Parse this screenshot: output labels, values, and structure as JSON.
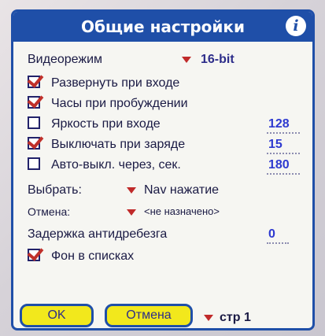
{
  "window": {
    "title": "Общие настройки",
    "info_icon": "info-icon"
  },
  "video_mode": {
    "label": "Видеорежим",
    "value": "16-bit"
  },
  "options": {
    "expand_on_start": {
      "label": "Развернуть при входе",
      "checked": true
    },
    "clock_on_wake": {
      "label": "Часы при пробуждении",
      "checked": true
    },
    "brightness_on_start": {
      "label": "Яркость при входе",
      "checked": false,
      "value": "128"
    },
    "off_on_charge": {
      "label": "Выключать при заряде",
      "checked": true,
      "value": "15"
    },
    "auto_off": {
      "label": "Авто-выкл. через, сек.",
      "checked": false,
      "value": "180"
    },
    "lists_background": {
      "label": "Фон в списках",
      "checked": true
    }
  },
  "select": {
    "label": "Выбрать:",
    "value": "Nav нажатие"
  },
  "cancel_action": {
    "label": "Отмена:",
    "value": "<не назначено>"
  },
  "antibounce": {
    "label": "Задержка антидребезга",
    "value": "0"
  },
  "buttons": {
    "ok": "OK",
    "cancel": "Отмена"
  },
  "page_selector": {
    "value": "стр 1"
  },
  "colors": {
    "accent": "#1f4fa8",
    "button_bg": "#f2e81c",
    "check": "#c0302a",
    "value_text": "#2e3ad0"
  }
}
